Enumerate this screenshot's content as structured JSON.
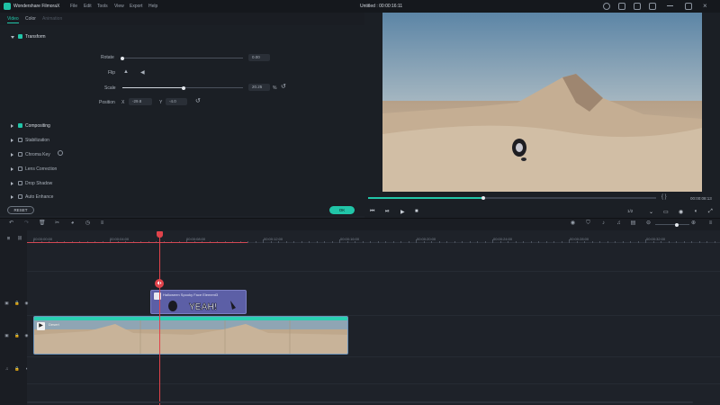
{
  "titlebar": {
    "app_name": "Wondershare FilmoraX",
    "menu": [
      "File",
      "Edit",
      "Tools",
      "View",
      "Export",
      "Help"
    ],
    "project": "Untitled : 00:00:16:11"
  },
  "tabs": [
    "Video",
    "Color",
    "Animation"
  ],
  "transform": {
    "title": "Transform",
    "rotate_label": "Rotate",
    "rotate_value": "0.00",
    "rotate_fraction": 0.0,
    "flip_label": "Flip",
    "scale_label": "Scale",
    "scale_value": "20.25",
    "scale_unit": "%",
    "scale_fraction": 0.51,
    "position_label": "Position",
    "x_label": "X",
    "x_value": "-29.8",
    "y_label": "Y",
    "y_value": "-4.0"
  },
  "sections": [
    {
      "label": "Compositing",
      "checked": true
    },
    {
      "label": "Stabilization",
      "checked": false
    },
    {
      "label": "Chroma Key",
      "checked": false
    },
    {
      "label": "Lens Correction",
      "checked": false
    },
    {
      "label": "Drop Shadow",
      "checked": false
    },
    {
      "label": "Auto Enhance",
      "checked": false
    }
  ],
  "buttons": {
    "reset": "RESET",
    "ok": "OK"
  },
  "preview": {
    "timecode": "00:00:08:13",
    "progress": 0.4,
    "bracket": "{ }",
    "quality": "1/2"
  },
  "timeline": {
    "ticks": [
      "00:00:00:00",
      "00:00:04:00",
      "00:00:08:00",
      "00:00:12:00",
      "00:00:16:00",
      "00:00:20:00",
      "00:00:24:00",
      "00:00:28:00",
      "00:00:32:00"
    ],
    "sticker_clip": "Halloween Spooky Face Element3",
    "video_clip": "Desert"
  },
  "colors": {
    "accent": "#21c5a8",
    "playhead": "#e0434b",
    "sticker_clip": "#5c5fa6"
  }
}
